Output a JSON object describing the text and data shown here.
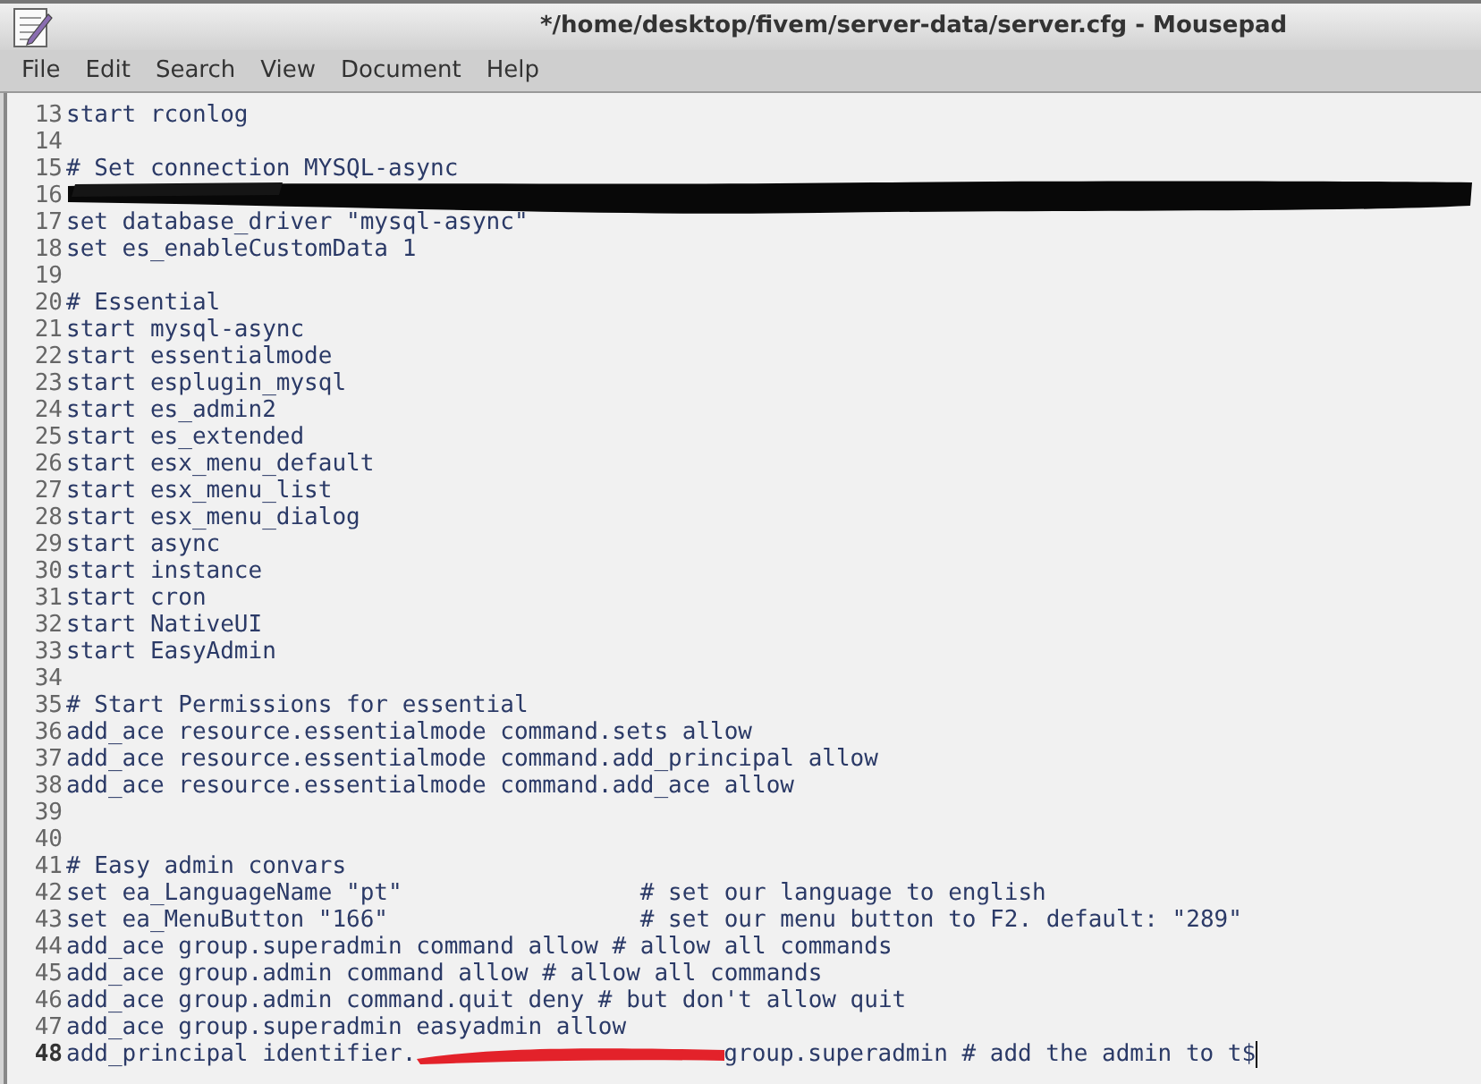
{
  "window": {
    "title": "*/home/desktop/fivem/server-data/server.cfg - Mousepad"
  },
  "menu": [
    "File",
    "Edit",
    "Search",
    "View",
    "Document",
    "Help"
  ],
  "editor": {
    "lines": [
      {
        "number": "13",
        "text": "start rconlog",
        "current": false
      },
      {
        "number": "14",
        "current": false
      },
      {
        "number": "15",
        "text": "# Set connection MYSQL-async",
        "current": false
      },
      {
        "number": "16",
        "current": false
      },
      {
        "number": "17",
        "text": "set database_driver \"mysql-async\"",
        "current": false
      },
      {
        "number": "18",
        "text": "set es_enableCustomData 1",
        "current": false
      },
      {
        "number": "19",
        "current": false
      },
      {
        "number": "20",
        "text": "# Essential",
        "current": false
      },
      {
        "number": "21",
        "text": "start mysql-async",
        "current": false
      },
      {
        "number": "22",
        "text": "start essentialmode",
        "current": false
      },
      {
        "number": "23",
        "text": "start esplugin_mysql",
        "current": false
      },
      {
        "number": "24",
        "text": "start es_admin2",
        "current": false
      },
      {
        "number": "25",
        "text": "start es_extended",
        "current": false
      },
      {
        "number": "26",
        "text": "start esx_menu_default",
        "current": false
      },
      {
        "number": "27",
        "text": "start esx_menu_list",
        "current": false
      },
      {
        "number": "28",
        "text": "start esx_menu_dialog",
        "current": false
      },
      {
        "number": "29",
        "text": "start async",
        "current": false
      },
      {
        "number": "30",
        "text": "start instance",
        "current": false
      },
      {
        "number": "31",
        "text": "start cron",
        "current": false
      },
      {
        "number": "32",
        "text": "start NativeUI",
        "current": false
      },
      {
        "number": "33",
        "text": "start EasyAdmin",
        "current": false
      },
      {
        "number": "34",
        "current": false
      },
      {
        "number": "35",
        "text": "# Start Permissions for essential",
        "current": false
      },
      {
        "number": "36",
        "text": "add_ace resource.essentialmode command.sets allow",
        "current": false
      },
      {
        "number": "37",
        "text": "add_ace resource.essentialmode command.add_principal allow",
        "current": false
      },
      {
        "number": "38",
        "text": "add_ace resource.essentialmode command.add_ace allow",
        "current": false
      },
      {
        "number": "39",
        "current": false
      },
      {
        "number": "40",
        "current": false
      },
      {
        "number": "41",
        "text": "# Easy admin convars",
        "current": false
      },
      {
        "number": "42",
        "text": "set ea_LanguageName \"pt\"                 # set our language to english",
        "current": false
      },
      {
        "number": "43",
        "text": "set ea_MenuButton \"166\"                  # set our menu button to F2. default: \"289\"",
        "current": false
      },
      {
        "number": "44",
        "text": "add_ace group.superadmin command allow # allow all commands",
        "current": false
      },
      {
        "number": "45",
        "text": "add_ace group.admin command allow # allow all commands",
        "current": false
      },
      {
        "number": "46",
        "text": "add_ace group.admin command.quit deny # but don't allow quit",
        "current": false
      },
      {
        "number": "47",
        "text": "add_ace group.superadmin easyadmin allow",
        "current": false
      },
      {
        "number": "48",
        "text": "add_principal identifier.",
        "current": true,
        "text_after": "group.superadmin # add the admin to t$"
      }
    ]
  }
}
